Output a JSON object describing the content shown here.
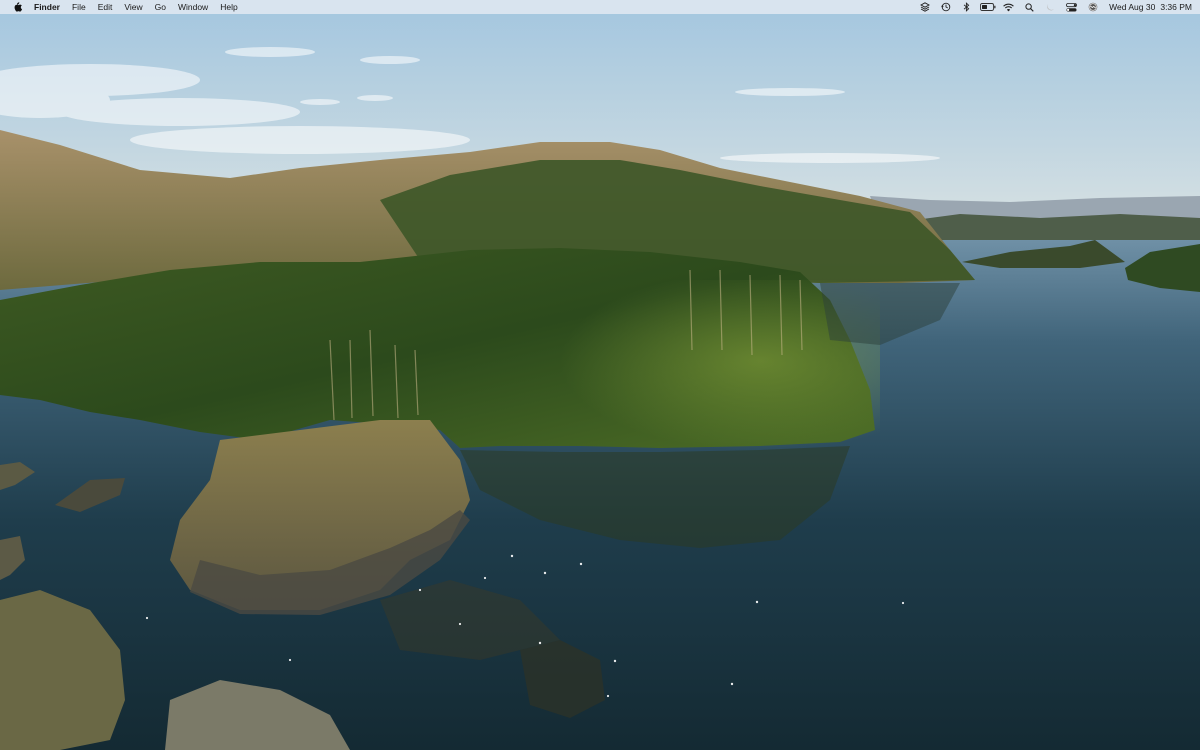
{
  "menubar": {
    "apple_menu_icon": "apple-logo-icon",
    "app_name": "Finder",
    "menus": [
      "File",
      "Edit",
      "View",
      "Go",
      "Window",
      "Help"
    ],
    "status_icons": [
      "layers-icon",
      "time-machine-icon",
      "bluetooth-icon",
      "battery-icon",
      "wifi-icon",
      "spotlight-search-icon",
      "focus-moon-icon",
      "control-center-icon",
      "siri-icon"
    ],
    "clock": {
      "date": "Wed Aug 30",
      "time": "3:36 PM"
    }
  },
  "desktop": {
    "wallpaper": "aerial-scottish-loch-wooded-island",
    "colors": {
      "sky_top": "#9fc3dc",
      "sky_horizon": "#d9e3e6",
      "water": "#1d3642",
      "forest": "#2f4a1e",
      "hill": "#8a7a4e"
    }
  }
}
